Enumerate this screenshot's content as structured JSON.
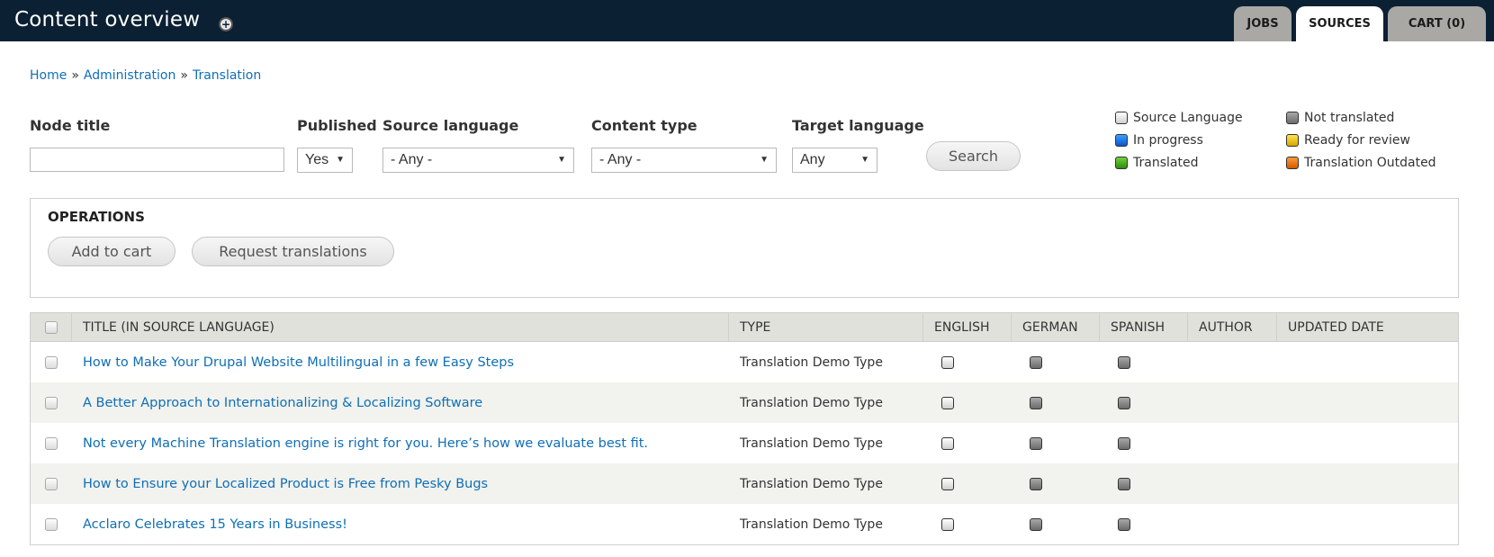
{
  "header": {
    "title": "Content overview",
    "add_icon": "plus-circle-icon",
    "tabs": [
      {
        "label": "JOBS",
        "active": false
      },
      {
        "label": "SOURCES",
        "active": true
      },
      {
        "label": "CART (0)",
        "active": false
      }
    ]
  },
  "breadcrumb": {
    "items": [
      "Home",
      "Administration",
      "Translation"
    ],
    "separator": "»"
  },
  "filters": {
    "node_title": {
      "label": "Node title",
      "value": "",
      "placeholder": ""
    },
    "published": {
      "label": "Published",
      "value": "Yes"
    },
    "source_language": {
      "label": "Source language",
      "value": "- Any -"
    },
    "content_type": {
      "label": "Content type",
      "value": "- Any -"
    },
    "target_language": {
      "label": "Target language",
      "value": "Any"
    },
    "search_label": "Search",
    "dropdown_arrow": "▼"
  },
  "legend": [
    {
      "key": "source",
      "label": "Source Language",
      "color": "#e8e8e8"
    },
    {
      "key": "not_translated",
      "label": "Not translated",
      "color": "#8a8a8a"
    },
    {
      "key": "in_progress",
      "label": "In progress",
      "color": "#0a6ee0"
    },
    {
      "key": "ready_for_review",
      "label": "Ready for review",
      "color": "#e6c000"
    },
    {
      "key": "translated",
      "label": "Translated",
      "color": "#3fa01e"
    },
    {
      "key": "outdated",
      "label": "Translation Outdated",
      "color": "#e86a10"
    }
  ],
  "operations": {
    "title": "OPERATIONS",
    "add_to_cart": "Add to cart",
    "request_translations": "Request translations"
  },
  "table": {
    "columns": [
      "TITLE (IN SOURCE LANGUAGE)",
      "TYPE",
      "ENGLISH",
      "GERMAN",
      "SPANISH",
      "AUTHOR",
      "UPDATED DATE"
    ],
    "rows": [
      {
        "title": "How to Make Your Drupal Website Multilingual in a few Easy Steps",
        "type": "Translation Demo Type",
        "english": "source",
        "german": "not_translated",
        "spanish": "not_translated",
        "author": "",
        "updated": ""
      },
      {
        "title": "A Better Approach to Internationalizing & Localizing Software",
        "type": "Translation Demo Type",
        "english": "source",
        "german": "not_translated",
        "spanish": "not_translated",
        "author": "",
        "updated": ""
      },
      {
        "title": "Not every Machine Translation engine is right for you. Here’s how we evaluate best fit.",
        "type": "Translation Demo Type",
        "english": "source",
        "german": "not_translated",
        "spanish": "not_translated",
        "author": "",
        "updated": ""
      },
      {
        "title": "How to Ensure your Localized Product is Free from Pesky Bugs",
        "type": "Translation Demo Type",
        "english": "source",
        "german": "not_translated",
        "spanish": "not_translated",
        "author": "",
        "updated": ""
      },
      {
        "title": "Acclaro Celebrates 15 Years in Business!",
        "type": "Translation Demo Type",
        "english": "source",
        "german": "not_translated",
        "spanish": "not_translated",
        "author": "",
        "updated": ""
      }
    ]
  }
}
